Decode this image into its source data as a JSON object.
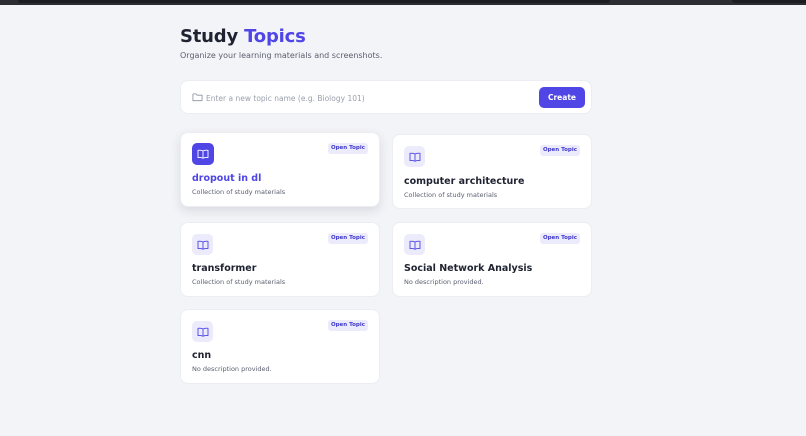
{
  "header": {
    "title_main": "Study",
    "title_accent": "Topics",
    "subtitle": "Organize your learning materials and screenshots."
  },
  "new_topic": {
    "placeholder": "Enter a new topic name (e.g. Biology 101)",
    "value": "",
    "create_label": "Create"
  },
  "colors": {
    "accent": "#4f46e5",
    "badge_bg": "#ecebfc",
    "background": "#f3f4f7"
  },
  "topics": [
    {
      "name": "dropout in dl",
      "description": "Collection of study materials",
      "action": "Open Topic",
      "icon": "book-icon",
      "highlighted": true
    },
    {
      "name": "computer architecture",
      "description": "Collection of study materials",
      "action": "Open Topic",
      "icon": "book-icon",
      "highlighted": false
    },
    {
      "name": "transformer",
      "description": "Collection of study materials",
      "action": "Open Topic",
      "icon": "book-icon",
      "highlighted": false
    },
    {
      "name": "Social Network Analysis",
      "description": "No description provided.",
      "action": "Open Topic",
      "icon": "book-icon",
      "highlighted": false
    },
    {
      "name": "cnn",
      "description": "No description provided.",
      "action": "Open Topic",
      "icon": "book-icon",
      "highlighted": false
    }
  ]
}
